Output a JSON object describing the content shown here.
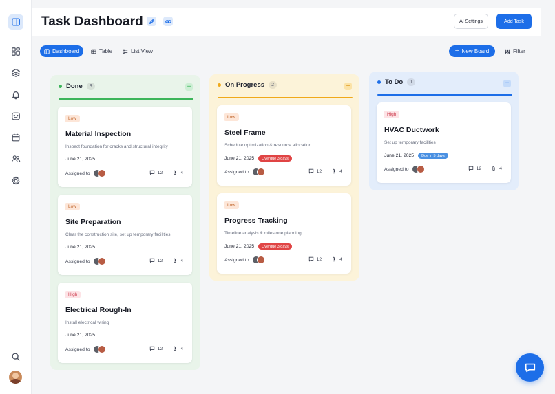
{
  "header": {
    "title": "Task Dashboard",
    "ai_settings_label": "AI Settings",
    "add_task_label": "Add Task"
  },
  "toolbar": {
    "views": [
      {
        "label": "Dashboard",
        "icon": "dashboard-icon",
        "active": true
      },
      {
        "label": "Table",
        "icon": "table-icon",
        "active": false
      },
      {
        "label": "List View",
        "icon": "list-icon",
        "active": false
      }
    ],
    "new_board_label": "New Board",
    "filter_label": "Filter"
  },
  "sidebar": {
    "items": [
      "panel-toggle-icon",
      "grid-icon",
      "layers-icon",
      "bell-icon",
      "message-icon",
      "calendar-icon",
      "users-icon",
      "gear-icon"
    ],
    "bottom": [
      "search-icon",
      "avatar"
    ]
  },
  "colors": {
    "accent": "#1d6ee8",
    "done": "#3cb55a",
    "progress": "#f0a91b",
    "todo": "#1d6ee8",
    "overdue": "#e04444",
    "due_soon": "#4a90e2"
  },
  "columns": {
    "done": {
      "title": "Done",
      "count": "3",
      "cards": [
        {
          "priority": "Low",
          "title": "Material Inspection",
          "desc": "Inspect foundation for cracks and structural integrity",
          "date": "June 21, 2025",
          "due": "",
          "assigned": "Assigned to",
          "comments": "12",
          "attachments": "4"
        },
        {
          "priority": "Low",
          "title": "Site Preparation",
          "desc": "Clear the construction site, set up temporary facilities",
          "date": "June 21, 2025",
          "due": "",
          "assigned": "Assigned to",
          "comments": "12",
          "attachments": "4"
        },
        {
          "priority": "High",
          "title": "Electrical Rough-In",
          "desc": "Install electrical wiring",
          "date": "June 21, 2025",
          "due": "",
          "assigned": "Assigned to",
          "comments": "12",
          "attachments": "4"
        }
      ]
    },
    "progress": {
      "title": "On Progress",
      "count": "2",
      "cards": [
        {
          "priority": "Low",
          "title": "Steel Frame",
          "desc": "Schedule optimization & resource allocation",
          "date": "June 21, 2025",
          "due": "Overdue 3 days",
          "assigned": "Assigned to",
          "comments": "12",
          "attachments": "4"
        },
        {
          "priority": "Low",
          "title": "Progress Tracking",
          "desc": "Timeline analysis & milestone planning",
          "date": "June 21, 2025",
          "due": "Overdue 3 days",
          "assigned": "Assigned to",
          "comments": "12",
          "attachments": "4"
        }
      ]
    },
    "todo": {
      "title": "To Do",
      "count": "1",
      "cards": [
        {
          "priority": "High",
          "title": "HVAC Ductwork",
          "desc": "Set up temporary facilities",
          "date": "June 21, 2025",
          "due": "Due in 5 days",
          "assigned": "Assigned to",
          "comments": "12",
          "attachments": "4"
        }
      ]
    }
  }
}
